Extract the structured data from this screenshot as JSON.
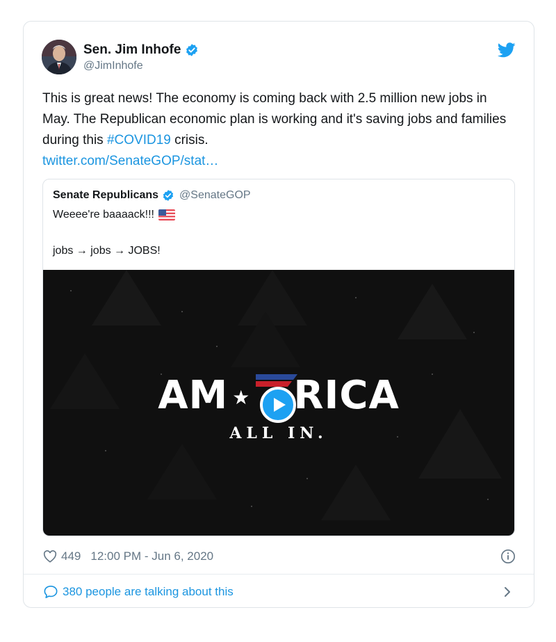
{
  "author": {
    "display_name": "Sen. Jim Inhofe",
    "handle": "@JimInhofe"
  },
  "tweet": {
    "text_1": "This is great news! The economy is coming back with 2.5 million new jobs in May. The Republican economic plan is working and it's saving jobs and families during this ",
    "hashtag": "#COVID19",
    "text_2": " crisis.",
    "link": "twitter.com/SenateGOP/stat…"
  },
  "quote": {
    "display_name": "Senate Republicans",
    "handle": "@SenateGOP",
    "line_1": "Weeee're baaaack!!!",
    "line_2": "jobs → jobs → JOBS!",
    "media_logo_left": "AM",
    "media_logo_right": "RICA",
    "media_tagline": "ALL IN."
  },
  "meta": {
    "likes": "449",
    "timestamp": "12:00 PM - Jun 6, 2020"
  },
  "footer": {
    "talking": "380 people are talking about this"
  },
  "colors": {
    "accent": "#1b95e0",
    "verified": "#1da1f2"
  }
}
